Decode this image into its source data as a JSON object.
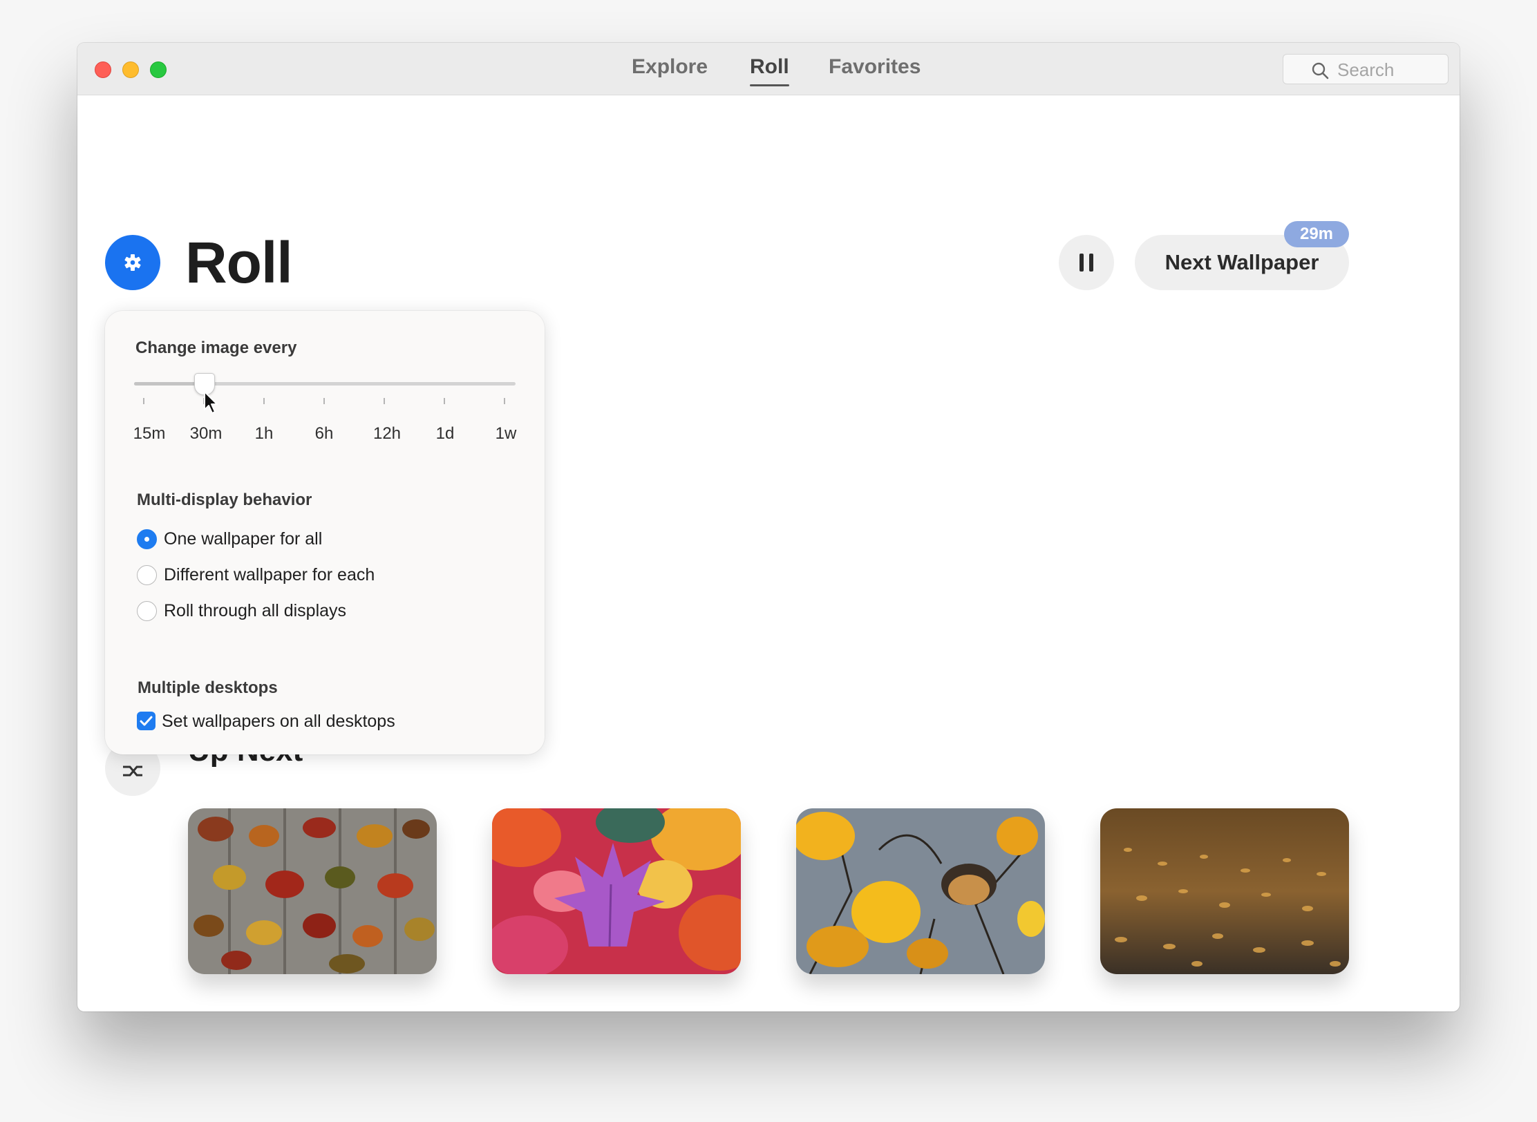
{
  "window": {
    "tabs": [
      {
        "label": "Explore",
        "active": false
      },
      {
        "label": "Roll",
        "active": true
      },
      {
        "label": "Favorites",
        "active": false
      }
    ],
    "search": {
      "placeholder": "Search",
      "icon": "search-icon"
    }
  },
  "header": {
    "title": "Roll",
    "settings_icon": "gear-icon",
    "pause_icon": "pause-icon",
    "next_button_label": "Next Wallpaper",
    "timer_badge": "29m"
  },
  "settings_popover": {
    "interval": {
      "label": "Change image every",
      "options": [
        "15m",
        "30m",
        "1h",
        "6h",
        "12h",
        "1d",
        "1w"
      ],
      "selected": "30m"
    },
    "multi_display": {
      "label": "Multi-display behavior",
      "options": [
        {
          "label": "One wallpaper for all",
          "selected": true
        },
        {
          "label": "Different wallpaper for each",
          "selected": false
        },
        {
          "label": "Roll through all displays",
          "selected": false
        }
      ]
    },
    "multiple_desktops": {
      "label": "Multiple desktops",
      "checkbox_label": "Set wallpapers on all desktops",
      "checked": true
    }
  },
  "up_next": {
    "title": "Up Next",
    "icon": "shuffle-icon",
    "thumbnails": [
      {
        "subject": "autumn-leaves-on-wood"
      },
      {
        "subject": "purple-maple-leaf"
      },
      {
        "subject": "yellow-leaves-street-lamp"
      },
      {
        "subject": "leaves-on-dark-ground"
      }
    ]
  },
  "colors": {
    "accent": "#1a73f0",
    "timer_badge": "#8ea9e0",
    "close": "#fe5f57",
    "minimize": "#febc2e",
    "maximize": "#28c840"
  }
}
